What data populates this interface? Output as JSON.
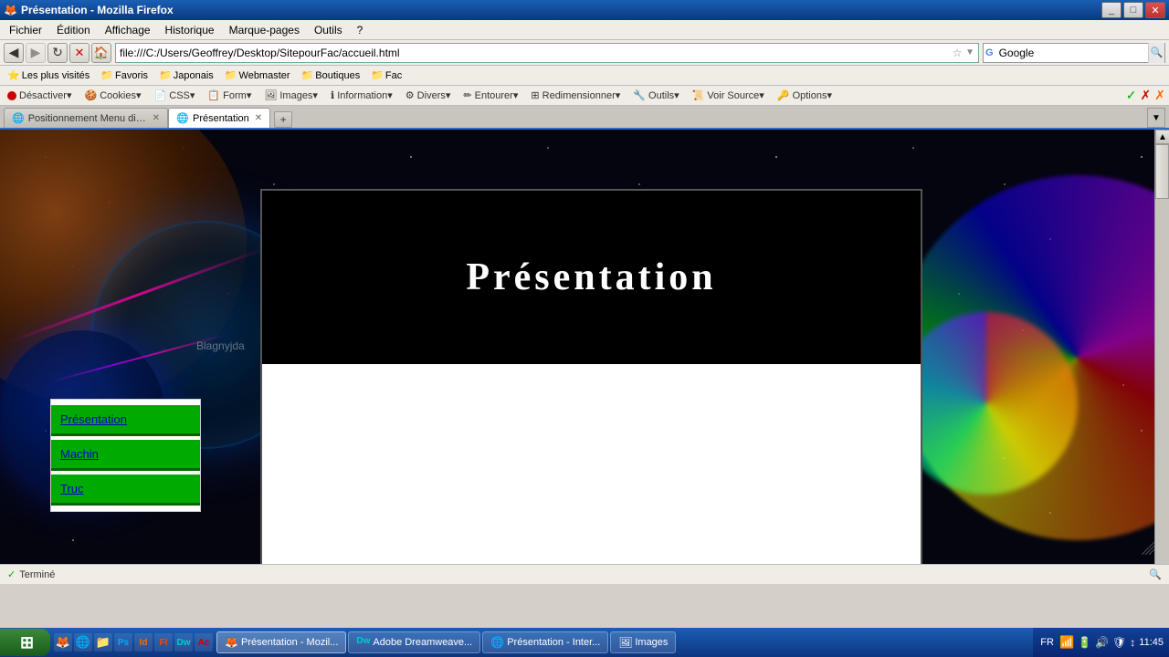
{
  "window": {
    "title": "Présentation - Mozilla Firefox",
    "icon": "🦊"
  },
  "menu": {
    "items": [
      "Fichier",
      "Édition",
      "Affichage",
      "Historique",
      "Marque-pages",
      "Outils",
      "?"
    ]
  },
  "address_bar": {
    "value": "file:///C:/Users/Geoffrey/Desktop/SitepourFac/accueil.html",
    "placeholder": ""
  },
  "search": {
    "value": "Google",
    "placeholder": "Google"
  },
  "bookmarks": {
    "items": [
      {
        "label": "Les plus visités",
        "icon": "⭐"
      },
      {
        "label": "Favoris",
        "icon": "📁"
      },
      {
        "label": "Japonais",
        "icon": "📁"
      },
      {
        "label": "Webmaster",
        "icon": "📁"
      },
      {
        "label": "Boutiques",
        "icon": "📁"
      },
      {
        "label": "Fac",
        "icon": "📁"
      }
    ]
  },
  "webdev": {
    "items": [
      {
        "label": "Désactiver▾",
        "type": "red"
      },
      {
        "label": "Cookies▾",
        "type": "cookie"
      },
      {
        "label": "CSS▾",
        "type": "css"
      },
      {
        "label": "Form▾",
        "type": "form"
      },
      {
        "label": "Images▾",
        "type": "images"
      },
      {
        "label": "Information▾",
        "type": "info"
      },
      {
        "label": "Divers▾",
        "type": "misc"
      },
      {
        "label": "Entourer▾",
        "type": "outline"
      },
      {
        "label": "Redimensionner▾",
        "type": "resize"
      },
      {
        "label": "Outils▾",
        "type": "tools"
      },
      {
        "label": "Voir Source▾",
        "type": "source"
      },
      {
        "label": "Options▾",
        "type": "options"
      }
    ],
    "status_ok": "✓",
    "status_err": "✗",
    "status_warn": "!"
  },
  "tabs": {
    "items": [
      {
        "label": "Positionnement Menu différent ent...",
        "active": false,
        "icon": "🌐"
      },
      {
        "label": "Présentation",
        "active": true,
        "icon": "🌐"
      }
    ]
  },
  "webpage": {
    "title": "Présentation",
    "blagnyjda_text": "Blagnyjda",
    "nav_menu": {
      "items": [
        {
          "label": "Présentation",
          "href": "#"
        },
        {
          "label": "Machin",
          "href": "#"
        },
        {
          "label": "Truc",
          "href": "#"
        }
      ]
    }
  },
  "status_bar": {
    "text": "Terminé",
    "icon": "✓"
  },
  "taskbar": {
    "time": "11:45",
    "language": "FR",
    "apps": [
      {
        "label": "Présentation - Mozil...",
        "icon": "🦊",
        "active": true
      },
      {
        "label": "Adobe Dreamweave...",
        "icon": "Dw",
        "active": false
      },
      {
        "label": "Présentation - Inter...",
        "icon": "🌐",
        "active": false
      },
      {
        "label": "Images",
        "icon": "🖼",
        "active": false
      }
    ],
    "system_icons": [
      "FR",
      "🔊",
      "🔋",
      "🕐"
    ]
  }
}
